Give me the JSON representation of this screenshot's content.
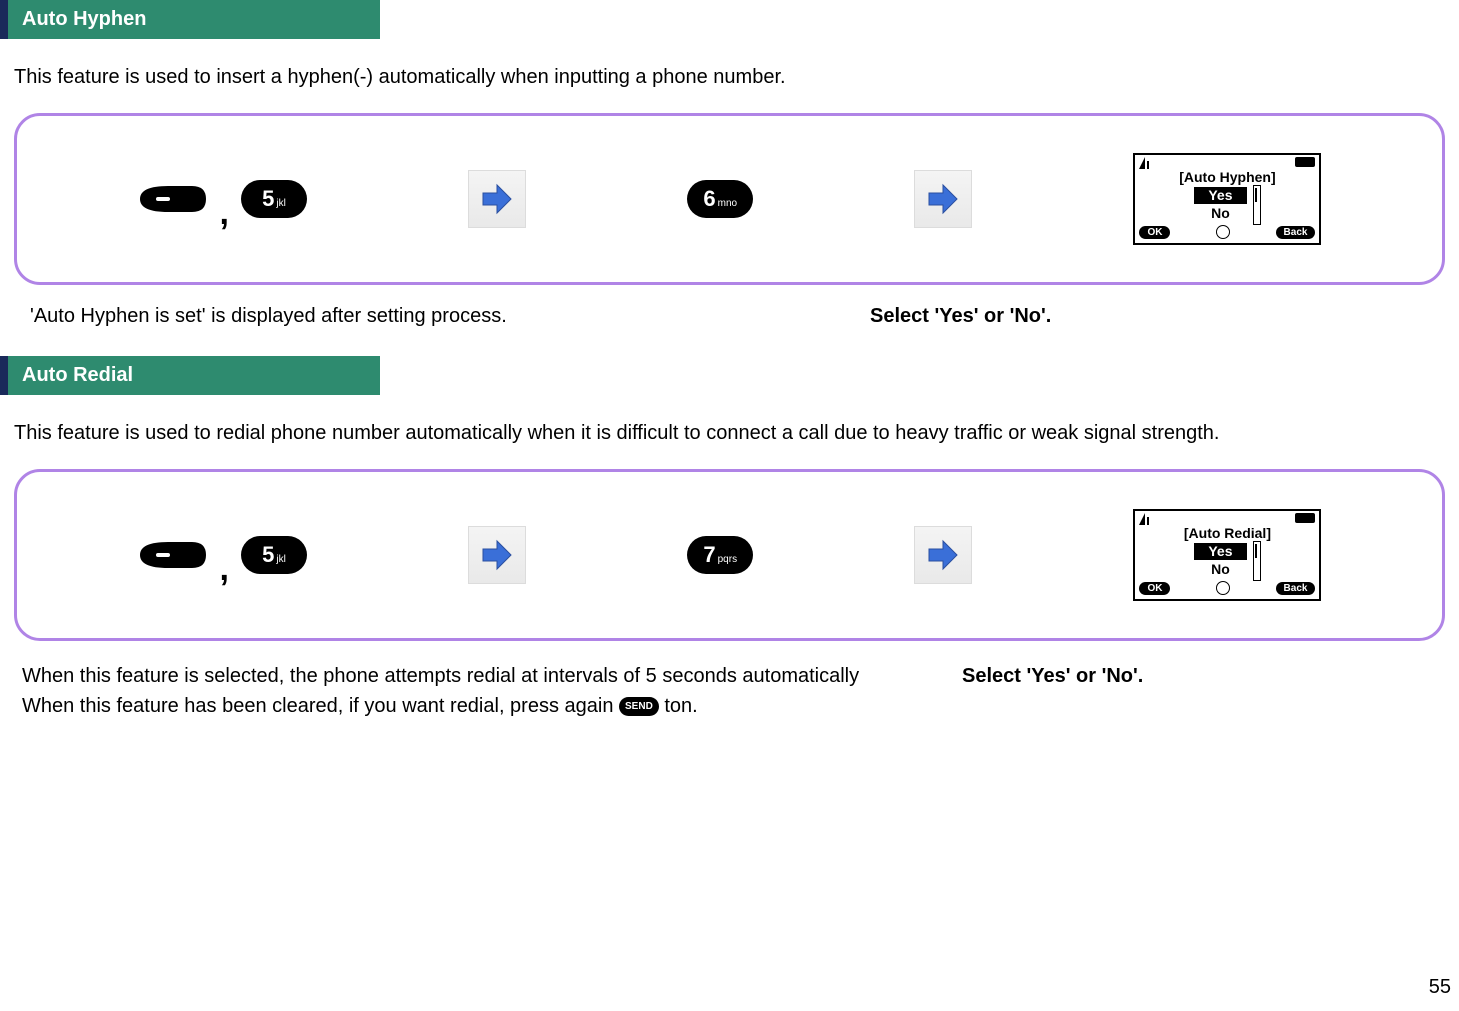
{
  "page_number": "55",
  "section1": {
    "title": "Auto Hyphen",
    "description": "This feature is used to insert a hyphen(-) automatically when inputting a phone number.",
    "key_number": "5",
    "key_letters": "jkl",
    "step_key_number": "6",
    "step_key_letters": "mno",
    "screen_title": "[Auto Hyphen]",
    "screen_opt_sel": "Yes",
    "screen_opt_unsel": "No",
    "screen_ok": "OK",
    "screen_back": "Back",
    "caption_left": "'Auto Hyphen is set' is displayed after setting process.",
    "caption_right": "Select 'Yes' or 'No'."
  },
  "section2": {
    "title": "Auto Redial",
    "description": "This feature is used to redial phone number automatically when it is difficult to connect a call due to heavy traffic or weak signal strength.",
    "key_number": "5",
    "key_letters": "jkl",
    "step_key_number": "7",
    "step_key_letters": "pqrs",
    "screen_title": "[Auto Redial]",
    "screen_opt_sel": "Yes",
    "screen_opt_unsel": "No",
    "screen_ok": "OK",
    "screen_back": "Back",
    "caption_line1": "When this feature is selected, the phone attempts redial at intervals of 5 seconds automatically",
    "caption_right": "Select 'Yes' or 'No'.",
    "caption_line2_pre": "When this feature has been cleared, if you want redial, press again ",
    "send_label": "SEND",
    "caption_line2_post": "ton."
  }
}
